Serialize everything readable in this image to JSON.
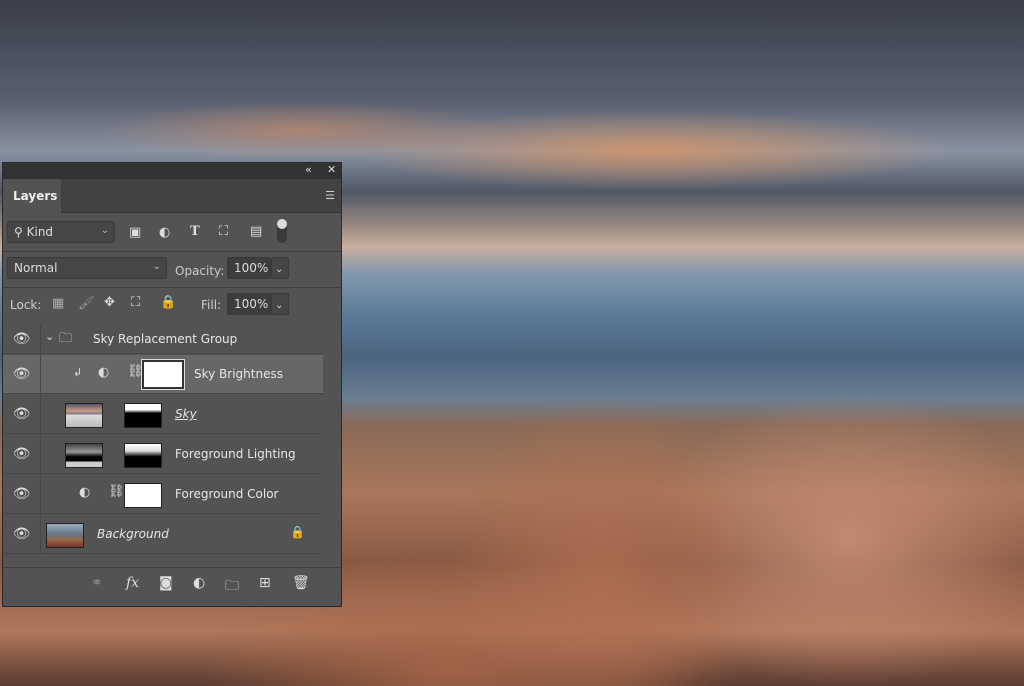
{
  "panel": {
    "title": "Layers",
    "collapse_icon": "double-chevron-left",
    "close_icon": "close"
  },
  "filter": {
    "kind_label": "Kind"
  },
  "blend": {
    "mode": "Normal",
    "opacity_label": "Opacity:",
    "opacity_value": "100%"
  },
  "lock": {
    "label": "Lock:",
    "fill_label": "Fill:",
    "fill_value": "100%"
  },
  "layers": [
    {
      "name": "Sky Replacement Group",
      "type": "group"
    },
    {
      "name": "Sky Brightness",
      "type": "adjustment",
      "selected": true
    },
    {
      "name": "Sky",
      "type": "pixel-with-mask"
    },
    {
      "name": "Foreground Lighting",
      "type": "pixel-with-mask"
    },
    {
      "name": "Foreground Color",
      "type": "adjustment"
    },
    {
      "name": "Background",
      "type": "background",
      "locked": true
    }
  ],
  "footer": {
    "fx_label": "fx"
  }
}
